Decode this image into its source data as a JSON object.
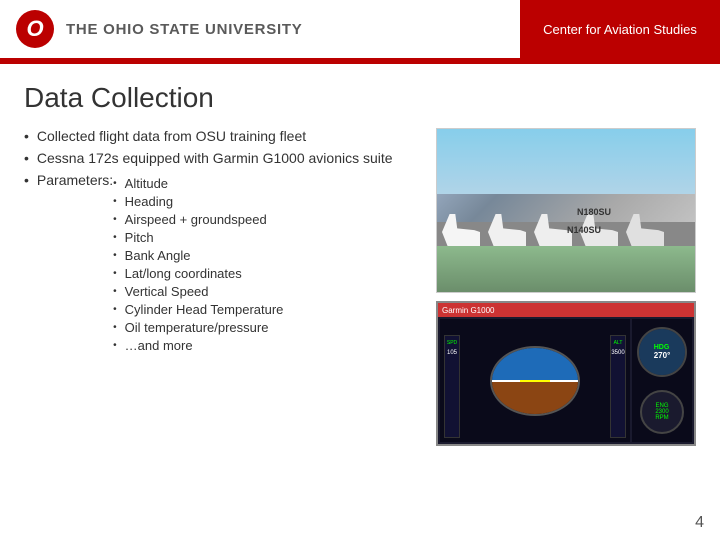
{
  "header": {
    "logo_letter": "O",
    "university_name": "THE OHIO STATE UNIVERSITY",
    "center_name": "Center for Aviation Studies"
  },
  "page": {
    "title": "Data Collection",
    "page_number": "4"
  },
  "bullets": {
    "items": [
      {
        "text": "Collected flight data from OSU training fleet"
      },
      {
        "text": "Cessna 172s equipped with Garmin G1000 avionics suite"
      },
      {
        "text": "Parameters:"
      }
    ]
  },
  "parameters": {
    "items": [
      "Altitude",
      "Heading",
      "Airspeed + groundspeed",
      "Pitch",
      "Bank Angle",
      "Lat/long coordinates",
      "Vertical Speed",
      "Cylinder Head Temperature",
      "Oil temperature/pressure",
      "…and more"
    ]
  },
  "images": {
    "planes_alt": "OSU Cessna 172 training fleet on tarmac",
    "avionics_alt": "Garmin G1000 avionics display",
    "reg_1": "N180SU",
    "reg_2": "N140SU"
  }
}
